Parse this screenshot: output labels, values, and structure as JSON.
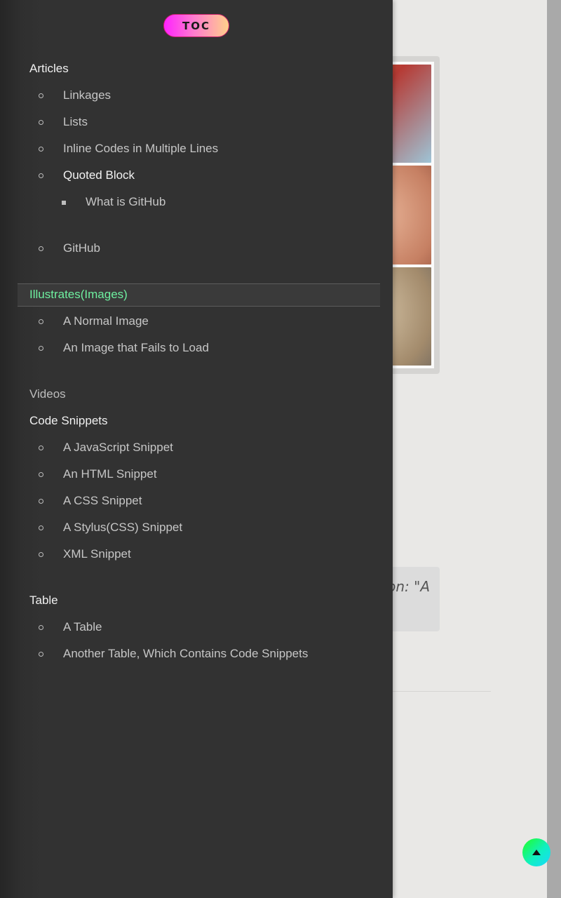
{
  "toc": {
    "badge": "TOC",
    "sections": [
      {
        "label": "Articles"
      },
      {
        "label": "Illustrates(Images)"
      },
      {
        "label": "Videos"
      },
      {
        "label": "Code Snippets"
      },
      {
        "label": "Table"
      }
    ],
    "articles_items": [
      "Linkages",
      "Lists",
      "Inline Codes in Multiple Lines",
      "Quoted Block",
      "GitHub"
    ],
    "quoted_sub": [
      "What is GitHub"
    ],
    "images_items": [
      "A Normal Image",
      "An Image that Fails to Load"
    ],
    "code_items": [
      "A JavaScript Snippet",
      "An HTML Snippet",
      "A CSS Snippet",
      "A Stylus(CSS) Snippet",
      "XML Snippet"
    ],
    "table_items": [
      "A Table",
      "Another Table, Which Contains Code Snippets"
    ],
    "active_section": "Illustrates(Images)",
    "active_color": "#6ef0a0"
  },
  "page": {
    "quote_fragment": "on: \"A"
  },
  "icons": {
    "back_to_top": "arrow-up-icon"
  }
}
